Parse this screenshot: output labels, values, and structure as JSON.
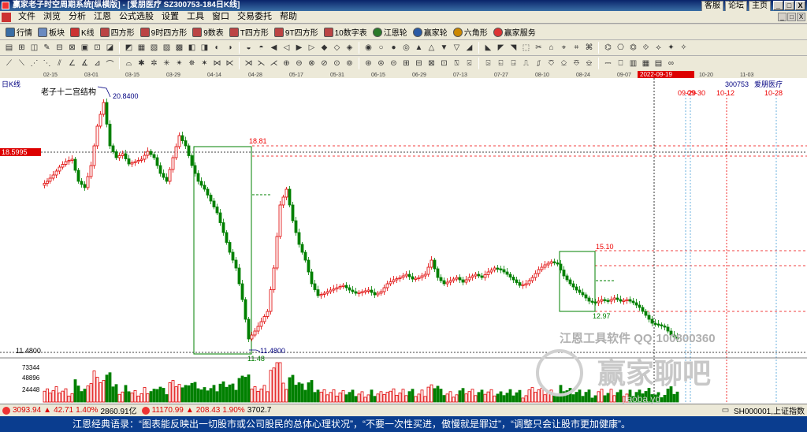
{
  "window": {
    "title": "赢家老子时空周期系统[纵横版] - [爱朋医疗   SZ300753-184日K线]",
    "links": [
      "客服",
      "论坛",
      "主页"
    ],
    "win_buttons": [
      "_",
      "□",
      "X"
    ]
  },
  "menu": {
    "items": [
      "文件",
      "浏览",
      "分析",
      "江恩",
      "公式选股",
      "设置",
      "工具",
      "窗口",
      "交易委托",
      "帮助"
    ],
    "mdi_buttons": [
      "_",
      "□",
      "X"
    ]
  },
  "toolbar1": {
    "items": [
      {
        "label": "行情",
        "icon": "quote-icon"
      },
      {
        "label": "板块",
        "icon": "sector-icon"
      },
      {
        "label": "K线",
        "icon": "kline-icon"
      },
      {
        "label": "四方形",
        "icon": "square-icon"
      },
      {
        "label": "9时四方形",
        "icon": "square9-icon"
      },
      {
        "label": "9数表",
        "icon": "number9-icon"
      },
      {
        "label": "T四方形",
        "icon": "tsquare-icon"
      },
      {
        "label": "9T四方形",
        "icon": "t9square-icon"
      },
      {
        "label": "10数字表",
        "icon": "number10-icon"
      },
      {
        "label": "江恩轮",
        "icon": "gann-wheel-icon"
      },
      {
        "label": "赢家轮",
        "icon": "winner-wheel-icon"
      },
      {
        "label": "六角形",
        "icon": "hexagon-icon"
      },
      {
        "label": "赢家服务",
        "icon": "service-icon"
      }
    ]
  },
  "chart": {
    "period_label": "日K线",
    "indicator_name": "老子十二宫结构",
    "stock_code": "300753",
    "stock_name": "爱朋医疗",
    "current_date": "2022-09-19",
    "dates_top": [
      "02-15",
      "03-01",
      "03-15",
      "03-29",
      "04-14",
      "04-28",
      "05-17",
      "05-31",
      "06-15",
      "06-29",
      "07-13",
      "07-27",
      "08-10",
      "08-24",
      "09-07",
      "10-06",
      "10-20",
      "11-03"
    ],
    "price_tag": "18.5995",
    "labels": {
      "high": "20.8400",
      "low_left": "11.4800",
      "low_marker": "11.4800",
      "low_box": "11.48",
      "box1_top": "18.81",
      "box2_top": "15.10",
      "box2_bottom": "12.97",
      "future_dates": [
        "09-29",
        "09-30",
        "10-12",
        "10-28"
      ]
    },
    "volume_ticks": [
      "73344",
      "48896",
      "24448"
    ],
    "watermark": "江恩工具软件 QQ:100800360",
    "logo_text": "赢家聊吧",
    "logo_sub": "jiaoba.yd",
    "colors": {
      "up": "#e00000",
      "down": "#008000",
      "box": "#008000",
      "dash_red": "#e00000",
      "cursor": "#000000",
      "future": "#4aa0d8"
    }
  },
  "chart_data": {
    "type": "candlestick",
    "title": "老子十二宫结构",
    "x_start": "2022-02-15",
    "ylim": [
      11.0,
      22.0
    ],
    "marks": {
      "high": 20.84,
      "low": 11.48,
      "box1_top": 18.81,
      "box2_top": 15.1,
      "box2_bottom": 12.97,
      "price_line": 18.5995
    }
  },
  "status": {
    "sh_index": "3093.94",
    "sh_change": "42.71",
    "sh_pct": "1.40%",
    "sh_amount": "2860.91亿",
    "sz_index": "11170.99",
    "sz_change": "208.43",
    "sz_pct": "1.90%",
    "sz_amount": "3702.7",
    "right_code": "SH000001,上证指数"
  },
  "marquee": "江恩经典语录：“图表能反映出一切股市或公司股民的总体心理状况”，“不要一次性买进，傲慢就是罪过”，“调整只会让股市更加健康”。"
}
